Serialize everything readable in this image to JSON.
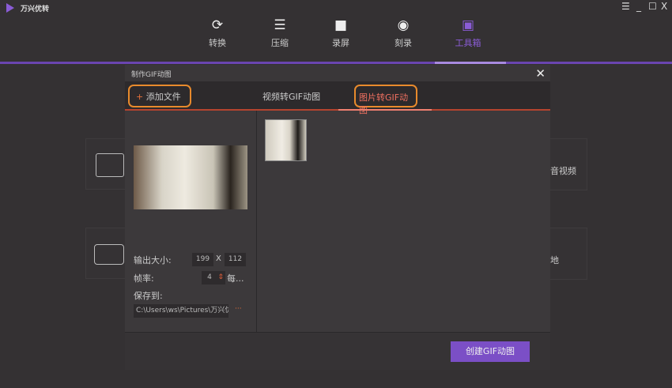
{
  "app": {
    "name": "万兴优转"
  },
  "window_controls": {
    "menu": "☰",
    "minimize": "_",
    "maximize": "☐",
    "close": "X"
  },
  "nav": [
    {
      "label": "转换",
      "icon": "convert-icon"
    },
    {
      "label": "压缩",
      "icon": "compress-icon"
    },
    {
      "label": "录屏",
      "icon": "record-icon"
    },
    {
      "label": "刻录",
      "icon": "burn-icon"
    },
    {
      "label": "工具箱",
      "icon": "toolbox-icon",
      "active": true
    }
  ],
  "background_cards": {
    "right1": "音视频",
    "right2": "地"
  },
  "dialog": {
    "title": "制作GIF动图",
    "add_file": "添加文件",
    "tabs": [
      "视频转GIF动图",
      "图片转GIF动图"
    ],
    "active_tab": 1,
    "output_size_label": "输出大小:",
    "width": "199",
    "x": "X",
    "height": "112",
    "fps_label": "帧率:",
    "fps": "4",
    "fps_unit": "每...",
    "save_to_label": "保存到:",
    "save_path": "C:\\Users\\ws\\Pictures\\万兴优转",
    "browse": "···",
    "create_button": "创建GIF动图"
  },
  "colors": {
    "accent": "#7b4fc6",
    "highlight": "#e88a2c",
    "tab_active": "#f08070"
  }
}
